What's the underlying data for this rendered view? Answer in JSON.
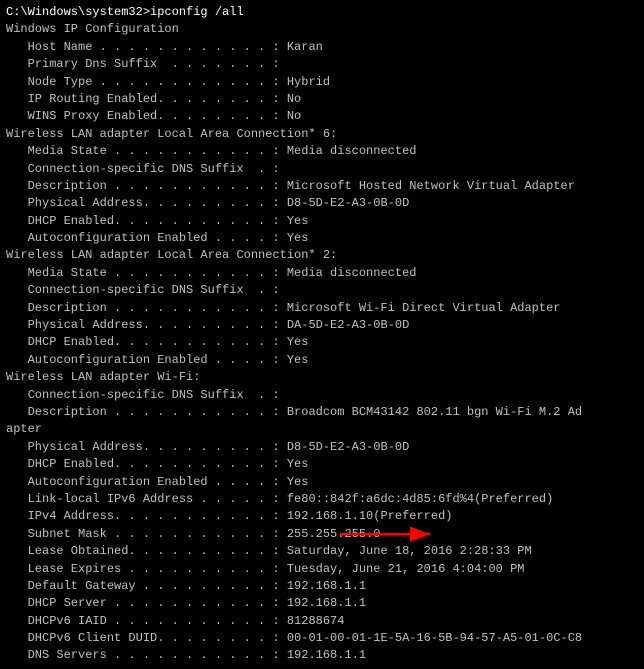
{
  "terminal": {
    "command_line": "C:\\Windows\\system32>ipconfig /all",
    "lines": [
      "",
      "Windows IP Configuration",
      "",
      "   Host Name . . . . . . . . . . . . : Karan",
      "   Primary Dns Suffix  . . . . . . . : ",
      "   Node Type . . . . . . . . . . . . : Hybrid",
      "   IP Routing Enabled. . . . . . . . : No",
      "   WINS Proxy Enabled. . . . . . . . : No",
      "",
      "Wireless LAN adapter Local Area Connection* 6:",
      "",
      "   Media State . . . . . . . . . . . : Media disconnected",
      "   Connection-specific DNS Suffix  . : ",
      "   Description . . . . . . . . . . . : Microsoft Hosted Network Virtual Adapter",
      "   Physical Address. . . . . . . . . : D8-5D-E2-A3-0B-0D",
      "   DHCP Enabled. . . . . . . . . . . : Yes",
      "   Autoconfiguration Enabled . . . . : Yes",
      "",
      "Wireless LAN adapter Local Area Connection* 2:",
      "",
      "   Media State . . . . . . . . . . . : Media disconnected",
      "   Connection-specific DNS Suffix  . : ",
      "   Description . . . . . . . . . . . : Microsoft Wi-Fi Direct Virtual Adapter",
      "   Physical Address. . . . . . . . . : DA-5D-E2-A3-0B-0D",
      "   DHCP Enabled. . . . . . . . . . . : Yes",
      "   Autoconfiguration Enabled . . . . : Yes",
      "",
      "Wireless LAN adapter Wi-Fi:",
      "",
      "   Connection-specific DNS Suffix  . : ",
      "   Description . . . . . . . . . . . : Broadcom BCM43142 802.11 bgn Wi-Fi M.2 Ad",
      "apter",
      "   Physical Address. . . . . . . . . : D8-5D-E2-A3-0B-0D",
      "   DHCP Enabled. . . . . . . . . . . : Yes",
      "   Autoconfiguration Enabled . . . . : Yes",
      "   Link-local IPv6 Address . . . . . : fe80::842f:a6dc:4d85:6fd%4(Preferred)",
      "   IPv4 Address. . . . . . . . . . . : 192.168.1.10(Preferred)",
      "   Subnet Mask . . . . . . . . . . . : 255.255.255.0",
      "   Lease Obtained. . . . . . . . . . : Saturday, June 18, 2016 2:28:33 PM",
      "   Lease Expires . . . . . . . . . . : Tuesday, June 21, 2016 4:04:00 PM",
      "   Default Gateway . . . . . . . . . : 192.168.1.1",
      "   DHCP Server . . . . . . . . . . . : 192.168.1.1",
      "   DHCPv6 IAID . . . . . . . . . . . : 81288674",
      "   DHCPv6 Client DUID. . . . . . . . : 00-01-00-01-1E-5A-16-5B-94-57-A5-01-0C-C8",
      "",
      "   DNS Servers . . . . . . . . . . . : 192.168.1.1"
    ],
    "arrow": {
      "visible": true,
      "color": "#ff0000"
    }
  }
}
